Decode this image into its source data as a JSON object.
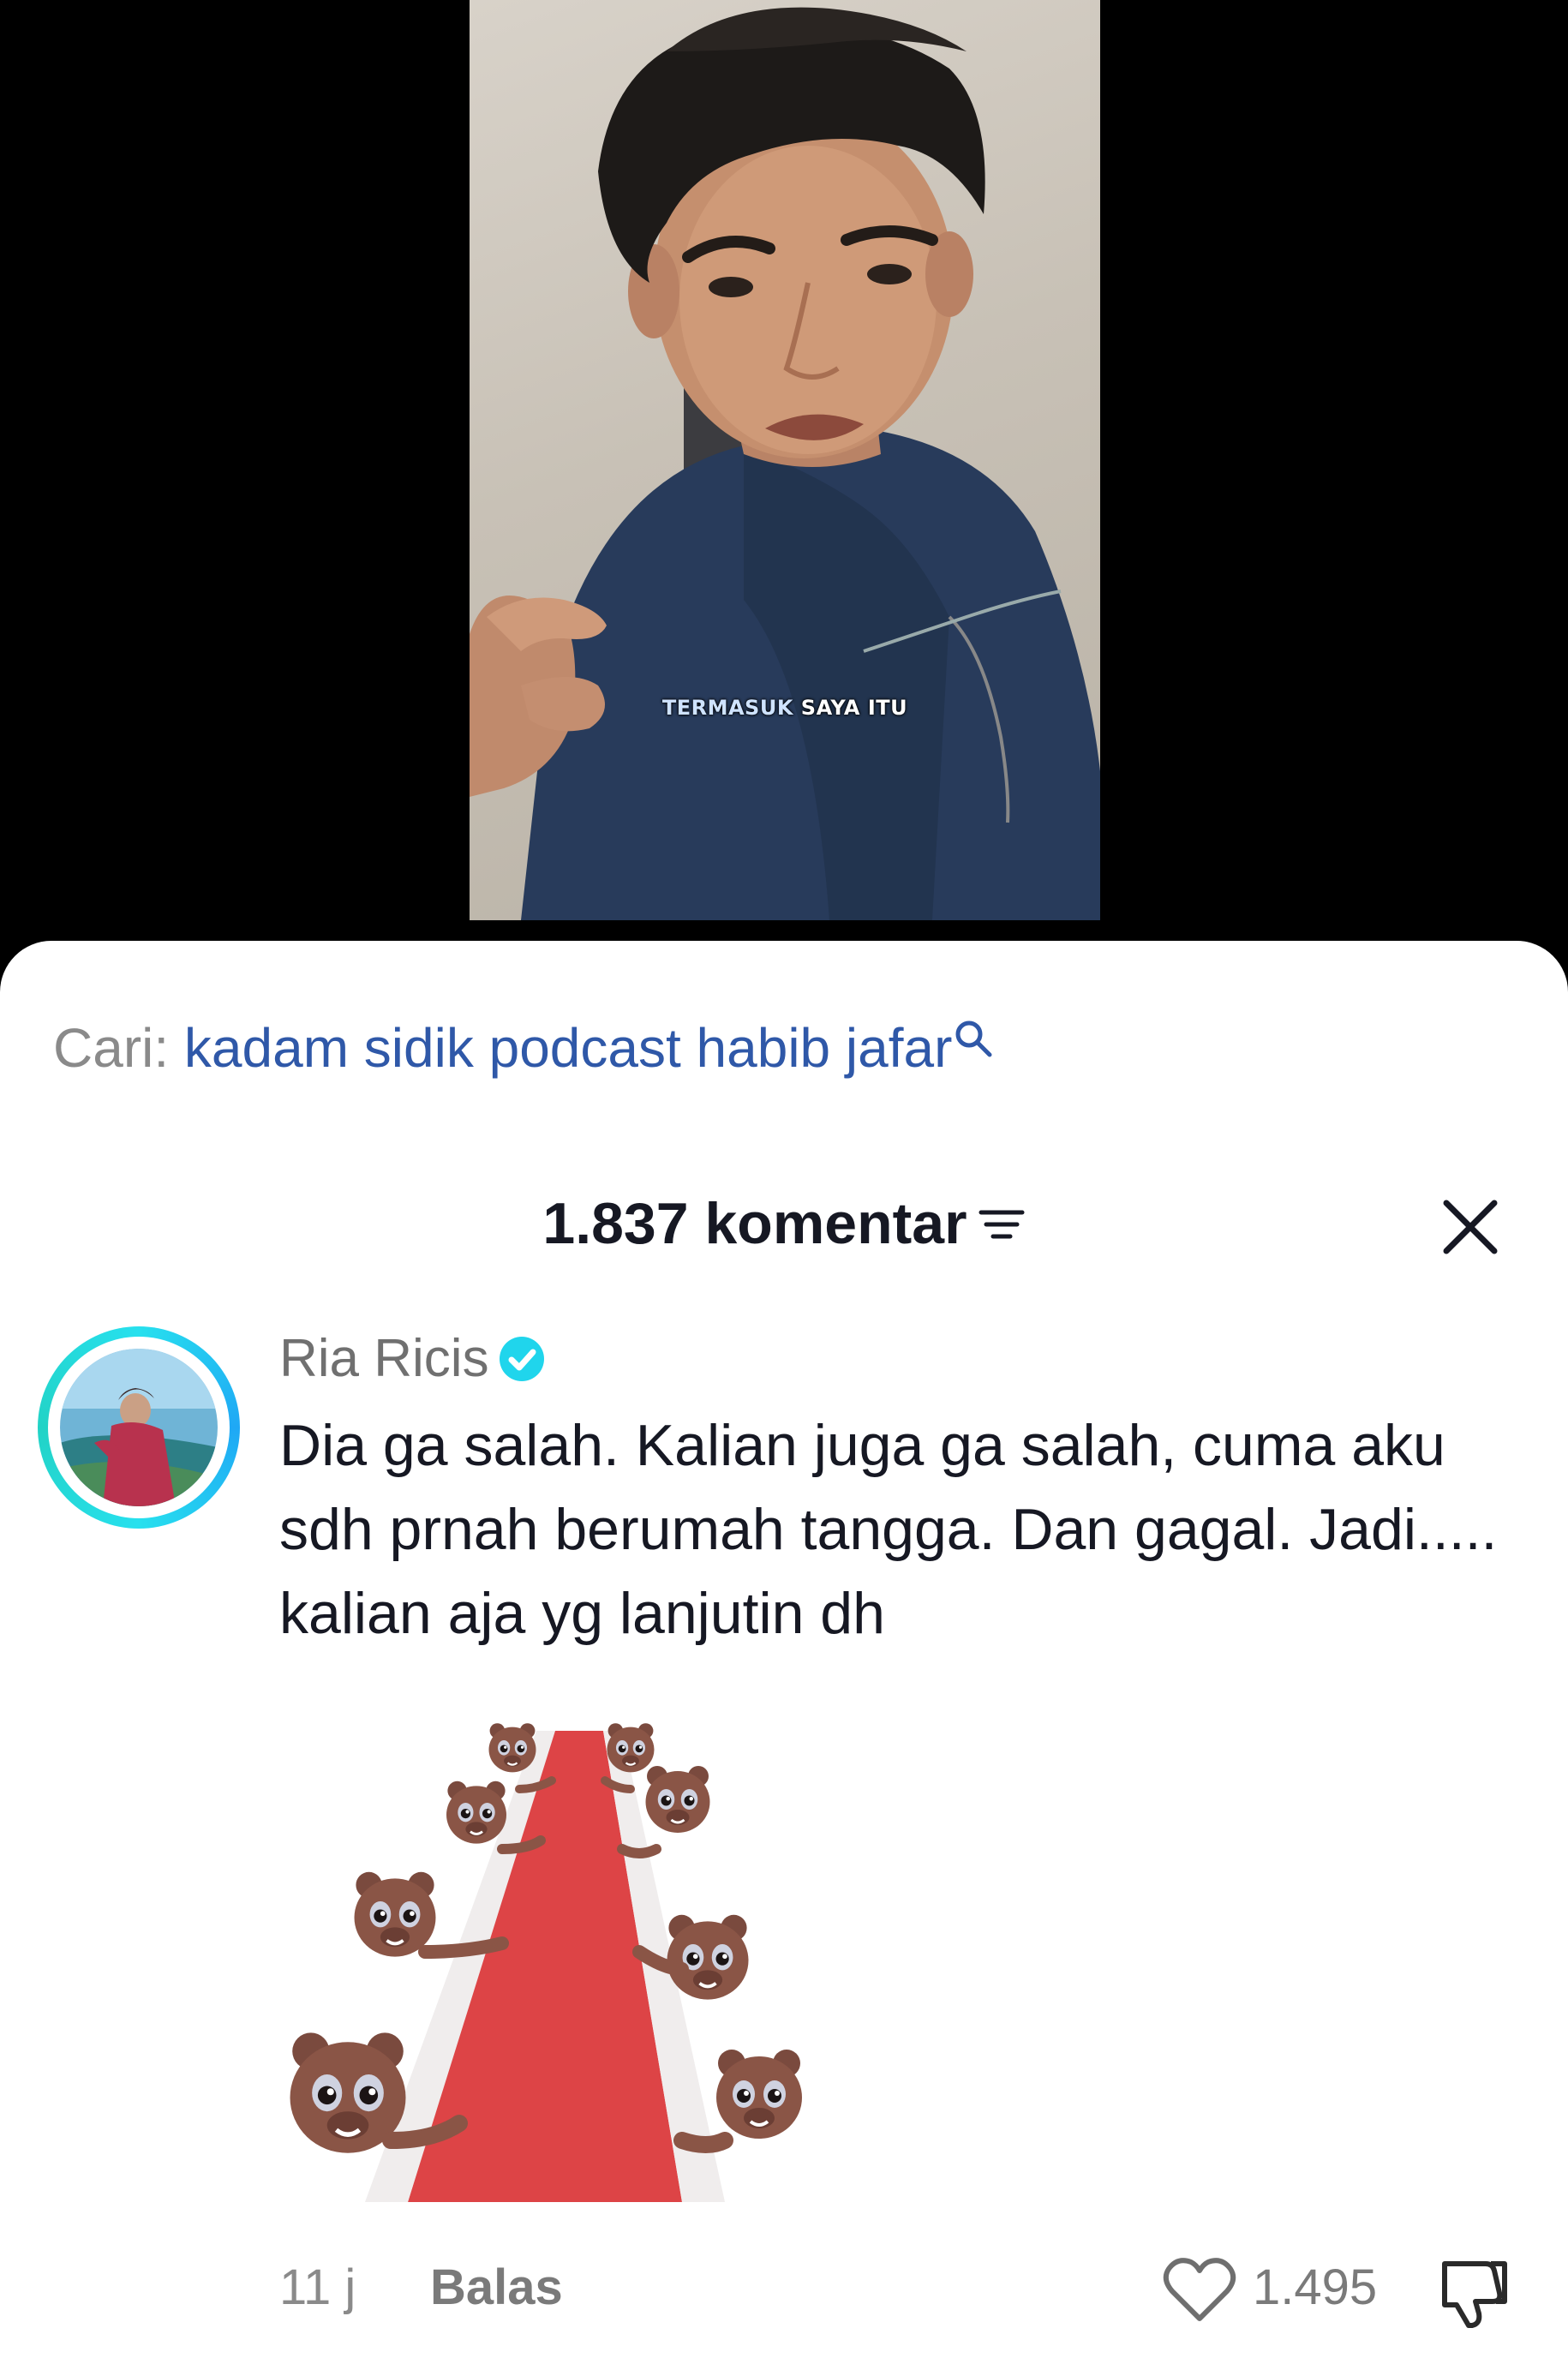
{
  "video": {
    "caption_highlight": "TERMASUK",
    "caption_rest": "SAYA ITU"
  },
  "search": {
    "prefix": "Cari:",
    "query": "kadam sidik podcast habib jafar",
    "icon": "search-icon"
  },
  "comments_header": {
    "count_label": "1.837 komentar",
    "sort_icon": "sort-lines-icon",
    "close_icon": "close-icon"
  },
  "comment": {
    "username": "Ria Ricis",
    "verified": true,
    "text": "Dia ga salah. Kalian juga ga salah, cuma aku sdh prnah berumah tangga. Dan gagal. Jadi..... kalian aja yg lanjutin dh",
    "sticker": "bears-red-carpet-sticker",
    "time": "11 j",
    "reply_label": "Balas",
    "like_count": "1.495"
  },
  "colors": {
    "search_query": "#2f58a8",
    "verified_badge": "#20d5ec",
    "avatar_ring": "#27e0ee",
    "red_carpet": "#dd4446"
  }
}
